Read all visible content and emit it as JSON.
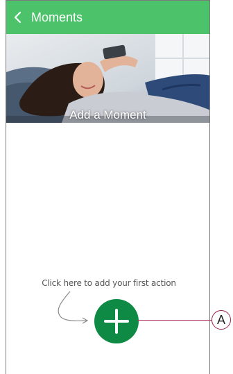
{
  "header": {
    "title": "Moments",
    "background": "#4cc36a"
  },
  "hero": {
    "label": "Add a Moment"
  },
  "main": {
    "hint": "Click here to add your first action",
    "add_button_color": "#0e8a45"
  },
  "callout": {
    "letter": "A",
    "color": "#9a2050"
  },
  "icons": {
    "back": "chevron-left-icon",
    "add": "plus-icon",
    "arrow": "curved-arrow-icon"
  }
}
